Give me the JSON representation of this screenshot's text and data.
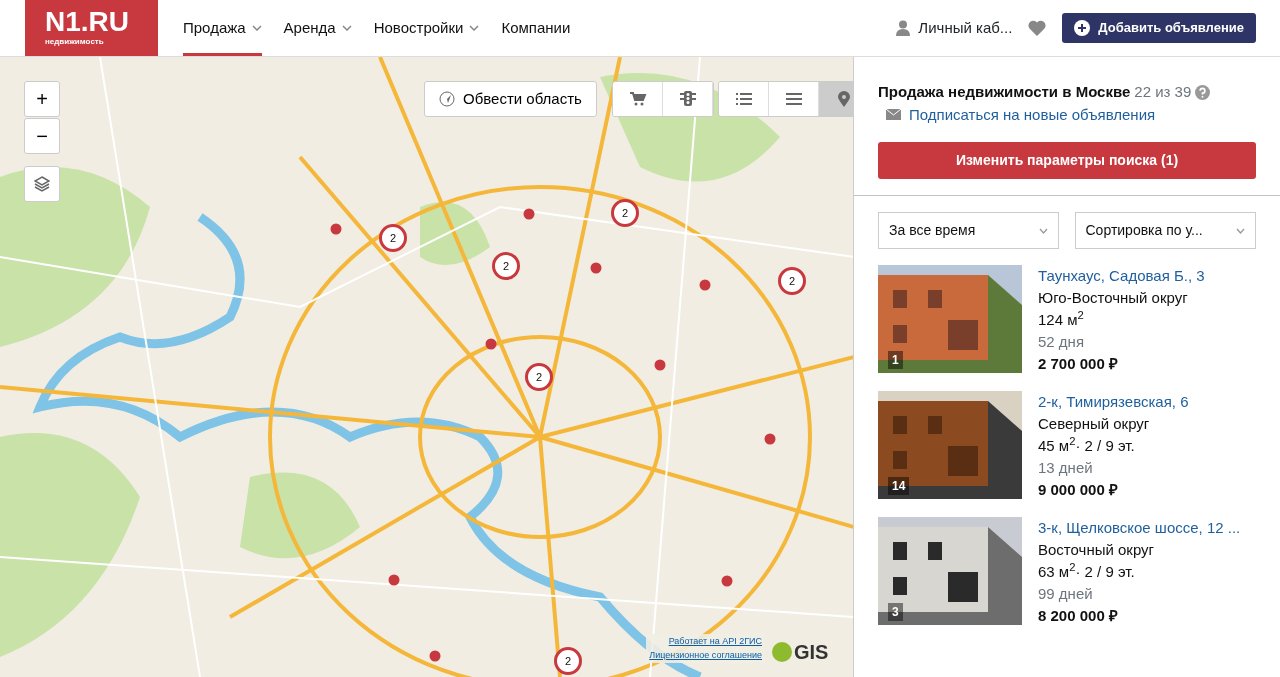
{
  "header": {
    "logo": {
      "title": "N1.RU",
      "subtitle": "недвижимость"
    },
    "nav": [
      {
        "label": "Продажа",
        "has_dropdown": true,
        "selected": true
      },
      {
        "label": "Аренда",
        "has_dropdown": true,
        "selected": false
      },
      {
        "label": "Новостройки",
        "has_dropdown": true,
        "selected": false
      },
      {
        "label": "Компании",
        "has_dropdown": false,
        "selected": false
      }
    ],
    "account": "Личный каб...",
    "add_button": "Добавить объявление"
  },
  "map": {
    "zoom": [
      "+",
      "−"
    ],
    "draw_area": "Обвести область",
    "layers": [
      {
        "kind": "cart",
        "selected": false
      },
      {
        "kind": "traffic",
        "selected": false
      }
    ],
    "views": [
      {
        "kind": "list",
        "selected": false
      },
      {
        "kind": "compact",
        "selected": false
      },
      {
        "kind": "map",
        "selected": true
      }
    ],
    "markers": [
      {
        "kind": "cluster",
        "count": "2"
      },
      {
        "kind": "cluster",
        "count": "2"
      },
      {
        "kind": "cluster",
        "count": "2"
      },
      {
        "kind": "cluster",
        "count": "2"
      },
      {
        "kind": "cluster",
        "count": "2"
      },
      {
        "kind": "cluster",
        "count": "2"
      },
      {
        "kind": "point"
      },
      {
        "kind": "point"
      },
      {
        "kind": "point"
      },
      {
        "kind": "point"
      },
      {
        "kind": "point"
      },
      {
        "kind": "point"
      },
      {
        "kind": "point"
      },
      {
        "kind": "point"
      },
      {
        "kind": "point"
      },
      {
        "kind": "point"
      }
    ],
    "attribution": [
      "Работает на API 2ГИС",
      "Лицензионное соглашение"
    ],
    "provider_logo": "GIS"
  },
  "results": {
    "title": "Продажа недвижимости в Москве",
    "count": "22 из 39",
    "subscribe": "Подписаться на новые объявления",
    "change_button": "Изменить параметры поиска (1)",
    "filters": [
      "За все время",
      "Сортировка по у..."
    ],
    "listings": [
      {
        "photo_count": "1",
        "title": "Таунхаус, Садовая Б., 3",
        "district": "Юго-Восточный округ",
        "details": "124 м$^{2}$",
        "age": "52 дня",
        "price": "2 700 000 ₽"
      },
      {
        "photo_count": "14",
        "title": "2-к, Тимирязевская, 6",
        "district": "Северный округ",
        "details": "45 м$^{2}$· 2 / 9 эт.",
        "age": "13 дней",
        "price": "9 000 000 ₽"
      },
      {
        "photo_count": "3",
        "title": "3-к, Щелковское шоссе, 12 ...",
        "district": "Восточный округ",
        "details": "63 м$^{2}$· 2 / 9 эт.",
        "age": "99 дней",
        "price": "8 200 000 ₽"
      }
    ]
  }
}
